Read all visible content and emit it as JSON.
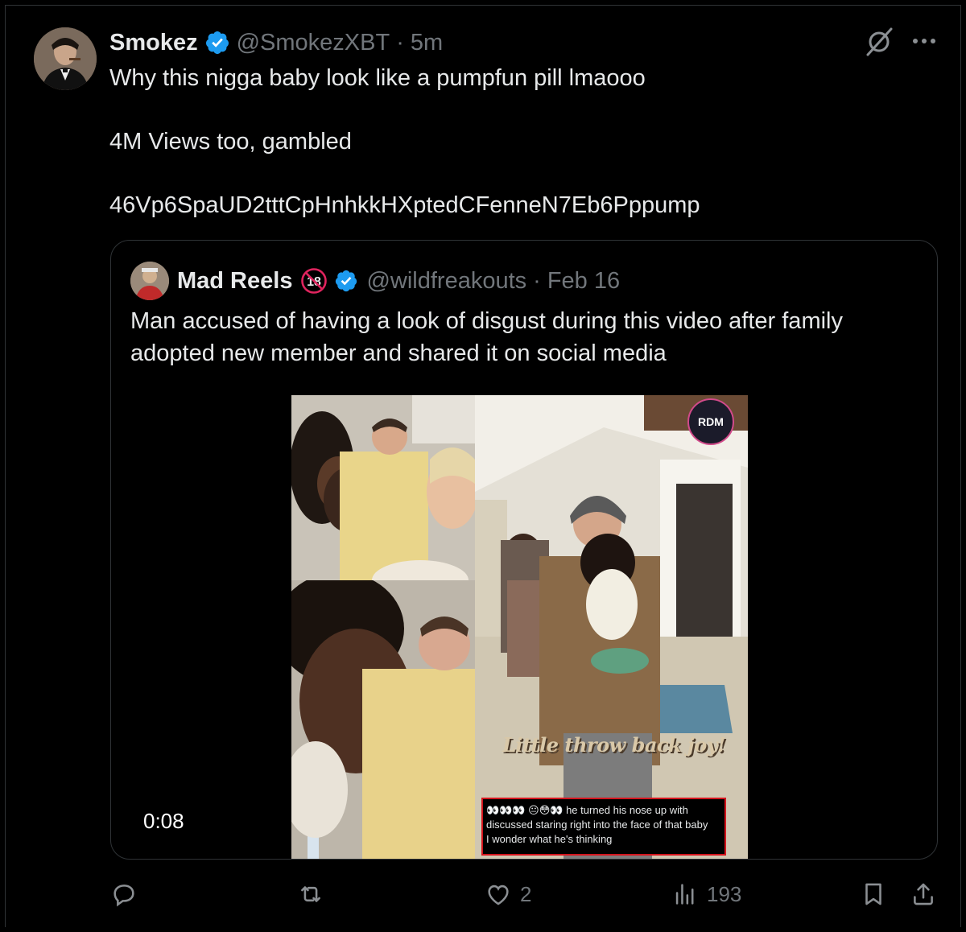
{
  "author": {
    "name": "Smokez",
    "handle": "@SmokezXBT",
    "separator": "·",
    "time": "5m"
  },
  "tweet": {
    "lines": [
      "Why this nigga baby look like a pumpfun pill lmaooo",
      "",
      "4M Views too, gambled",
      "",
      "46Vp6SpaUD2tttCpHnhkkHXptedCFenneN7Eb6Pppump"
    ]
  },
  "quote": {
    "name": "Mad Reels",
    "handle": "@wildfreakouts",
    "separator": "·",
    "date": "Feb 16",
    "text": "Man accused of having a look of disgust during this video after family adopted new member and shared it on social media",
    "video": {
      "duration": "0:08",
      "overlay_text": "Little throw back joy!",
      "watermark": "RDM",
      "caption_lines": [
        "👀👀👀 😐😳👀 he turned his nose up with",
        "discussed staring right into the face of that baby",
        "I wonder what he's thinking"
      ]
    }
  },
  "actions": {
    "reply_count": "",
    "repost_count": "",
    "like_count": "2",
    "views_count": "193"
  },
  "icons": {
    "verified": "verified-badge-icon",
    "grok": "grok-icon",
    "more": "more-icon",
    "reply": "reply-icon",
    "repost": "repost-icon",
    "like": "heart-icon",
    "views": "views-icon",
    "bookmark": "bookmark-icon",
    "share": "share-icon"
  },
  "colors": {
    "background": "#000000",
    "text": "#e7e9ea",
    "secondary": "#71767b",
    "verified": "#1d9bf0",
    "border": "#2f3336"
  }
}
